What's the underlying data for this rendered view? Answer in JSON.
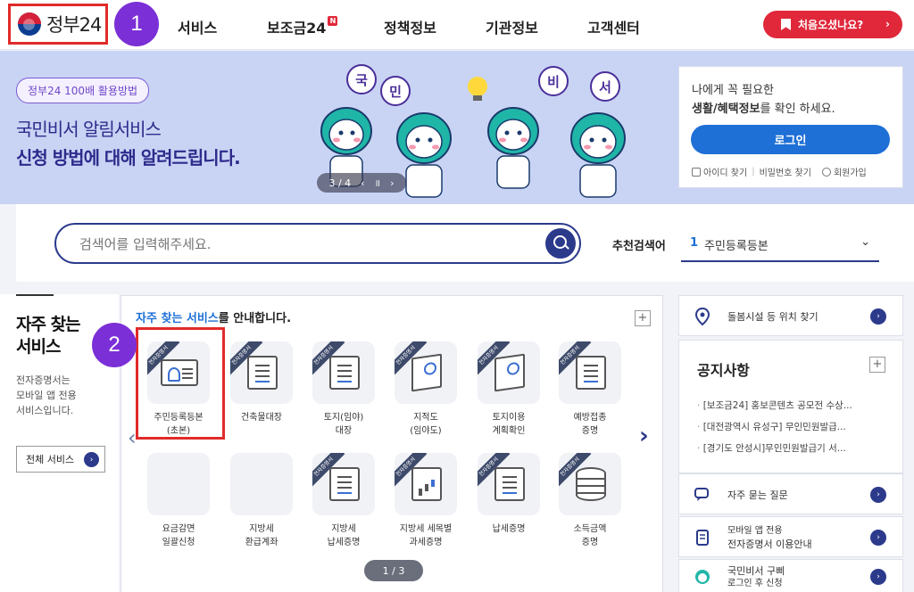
{
  "header": {
    "logo_text": "정부24",
    "nav": [
      {
        "label": "서비스"
      },
      {
        "label": "보조금24",
        "badge": "N"
      },
      {
        "label": "정책정보"
      },
      {
        "label": "기관정보"
      },
      {
        "label": "고객센터"
      }
    ],
    "first_visit_label": "처음오셨나요?",
    "first_visit_arrow": "›"
  },
  "annotations": {
    "step1": "1",
    "step2": "2"
  },
  "banner": {
    "pill": "정부24 100배 활용방법",
    "title": "국민비서 알림서비스",
    "subtitle": "신청 방법에 대해 알려드립니다.",
    "carousel": {
      "counter": "3 / 4",
      "prev": "‹",
      "pause": "॥",
      "next": "›"
    },
    "speech_letters": [
      "국",
      "민",
      "비",
      "서"
    ]
  },
  "login": {
    "line1": "나에게 꼭 필요한",
    "line2_bold": "생활/혜택정보",
    "line2_rest": "를 확인 하세요.",
    "button": "로그인",
    "find_id": "아이디 찾기",
    "find_pw": "비밀번호 찾기",
    "signup": "회원가입"
  },
  "search": {
    "placeholder": "검색어를 입력해주세요.",
    "recommended_label": "추천검색어",
    "recommended_rank": "1",
    "recommended_term": "주민등록등본",
    "dropdown_icon": "⌄"
  },
  "left": {
    "title_line1": "자주 찾는",
    "title_line2": "서비스",
    "desc_line1": "전자증명서는",
    "desc_line2": "모바일 앱 전용",
    "desc_line3": "서비스입니다.",
    "all_button": "전체 서비스",
    "all_arrow": "›"
  },
  "services": {
    "heading_blue": "자주 찾는 서비스",
    "heading_rest": "를 안내합니다.",
    "plus": "+",
    "ribbon": "전자증명서",
    "prev_arrow": "‹",
    "next_arrow": "›",
    "page": "1 / 3",
    "items": [
      {
        "line1": "주민등록등본",
        "line2": "(초본)",
        "ribbon": true,
        "icon": "id-card-icon"
      },
      {
        "line1": "건축물대장",
        "line2": "",
        "ribbon": true,
        "icon": "building-doc-icon"
      },
      {
        "line1": "토지(임야)",
        "line2": "대장",
        "ribbon": true,
        "icon": "land-ledger-icon"
      },
      {
        "line1": "지적도",
        "line2": "(임야도)",
        "ribbon": true,
        "icon": "cadastral-map-icon"
      },
      {
        "line1": "토지이용",
        "line2": "계획확인",
        "ribbon": true,
        "icon": "land-use-map-icon"
      },
      {
        "line1": "예방접종",
        "line2": "증명",
        "ribbon": true,
        "icon": "vaccination-icon"
      },
      {
        "line1": "요금감면",
        "line2": "일괄신청",
        "ribbon": false,
        "icon": "fee-reduction-icon"
      },
      {
        "line1": "지방세",
        "line2": "환급계좌",
        "ribbon": false,
        "icon": "tax-refund-icon"
      },
      {
        "line1": "지방세",
        "line2": "납세증명",
        "ribbon": true,
        "icon": "local-tax-doc-icon"
      },
      {
        "line1": "지방세 세목별",
        "line2": "과세증명",
        "ribbon": true,
        "icon": "tax-chart-icon"
      },
      {
        "line1": "납세증명",
        "line2": "",
        "ribbon": true,
        "icon": "tax-payment-icon"
      },
      {
        "line1": "소득금액",
        "line2": "증명",
        "ribbon": true,
        "icon": "income-db-icon"
      }
    ]
  },
  "right": {
    "care_facility": "돌봄시설 등 위치 찾기",
    "notice_title": "공지사항",
    "notice_plus": "+",
    "notices": [
      "[보조금24] 홍보콘텐츠 공모전 수상...",
      "[대전광역시 유성구] 무인민원발급...",
      "[경기도 안성시]무인민원발급기 서..."
    ],
    "faq": "자주 묻는 질문",
    "mobile_line1": "모바일 앱 전용",
    "mobile_line2": "전자증명서 이용안내",
    "secretary_line1": "국민비서 구삐",
    "secretary_line2": "로그인 후 신청",
    "go_arrow": "›"
  },
  "colors": {
    "brand_navy": "#2c3a8c",
    "accent_red": "#e0283a",
    "login_blue": "#1e6fd6",
    "annotation_purple": "#7b2fd6",
    "banner_bg": "#c9d4f4"
  }
}
